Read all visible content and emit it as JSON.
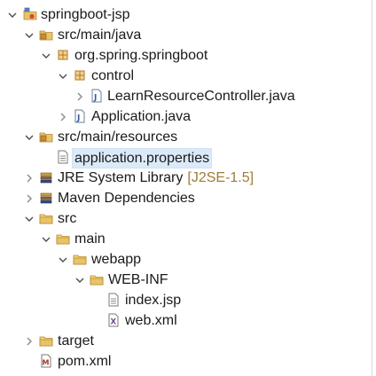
{
  "tree": {
    "items": [
      {
        "label": "springboot-jsp",
        "icon": "project-icon",
        "expanded": true
      },
      {
        "label": "src/main/java",
        "icon": "source-folder-icon",
        "expanded": true
      },
      {
        "label": "org.spring.springboot",
        "icon": "package-icon",
        "expanded": true
      },
      {
        "label": "control",
        "icon": "package-icon",
        "expanded": true
      },
      {
        "label": "LearnResourceController.java",
        "icon": "java-file-icon",
        "expanded": false
      },
      {
        "label": "Application.java",
        "icon": "java-file-icon",
        "expanded": false
      },
      {
        "label": "src/main/resources",
        "icon": "source-folder-icon",
        "expanded": true
      },
      {
        "label": "application.properties",
        "icon": "properties-file-icon",
        "selected": true
      },
      {
        "label": "JRE System Library",
        "decoration": "[J2SE-1.5]",
        "icon": "library-icon",
        "expanded": false
      },
      {
        "label": "Maven Dependencies",
        "icon": "library-icon",
        "expanded": false
      },
      {
        "label": "src",
        "icon": "folder-icon",
        "expanded": true
      },
      {
        "label": "main",
        "icon": "folder-icon",
        "expanded": true
      },
      {
        "label": "webapp",
        "icon": "folder-icon",
        "expanded": true
      },
      {
        "label": "WEB-INF",
        "icon": "folder-icon",
        "expanded": true
      },
      {
        "label": "index.jsp",
        "icon": "jsp-file-icon"
      },
      {
        "label": "web.xml",
        "icon": "xml-file-icon"
      },
      {
        "label": "target",
        "icon": "folder-icon",
        "expanded": false
      },
      {
        "label": "pom.xml",
        "icon": "maven-pom-icon"
      }
    ]
  },
  "colors": {
    "selection": "#dbeaf8",
    "decoration": "#a07b3a",
    "folder": "#e8c36a",
    "twisty": "#4d4d4d"
  }
}
